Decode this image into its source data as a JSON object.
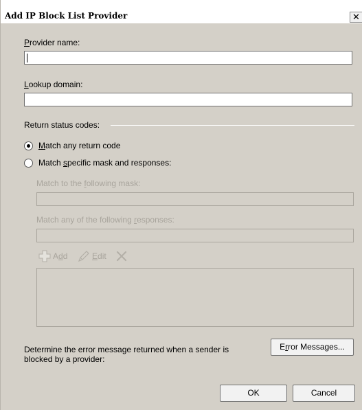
{
  "window": {
    "title": "Add IP Block List Provider",
    "close_glyph": "✕"
  },
  "provider_name": {
    "label_access": "P",
    "label_rest": "rovider name:",
    "value": ""
  },
  "lookup_domain": {
    "label_access": "L",
    "label_rest": "ookup domain:",
    "value": ""
  },
  "return_status": {
    "group_label": "Return status codes:",
    "option_any": {
      "label_pre": "",
      "label_access": "M",
      "label_rest": "atch any return code",
      "selected": true
    },
    "option_specific": {
      "label_pre": "Match ",
      "label_access": "s",
      "label_rest": "pecific mask and responses:",
      "selected": false
    },
    "mask": {
      "label_pre": "Match to the ",
      "label_access": "f",
      "label_rest": "ollowing mask:",
      "value": ""
    },
    "responses": {
      "label_pre": "Match any of the following ",
      "label_access": "r",
      "label_rest": "esponses:",
      "value": ""
    },
    "toolbar": {
      "add_pre": "A",
      "add_access": "d",
      "add_rest": "d",
      "edit_pre": "",
      "edit_access": "E",
      "edit_rest": "dit",
      "add_icon": "plus-icon",
      "edit_icon": "pencil-icon",
      "remove_icon": "delete-x-icon"
    }
  },
  "error_messages": {
    "description": "Determine the error message returned when a sender is blocked by a provider:",
    "button_pre": "E",
    "button_access": "r",
    "button_rest": "ror Messages..."
  },
  "footer": {
    "ok": "OK",
    "cancel": "Cancel"
  }
}
